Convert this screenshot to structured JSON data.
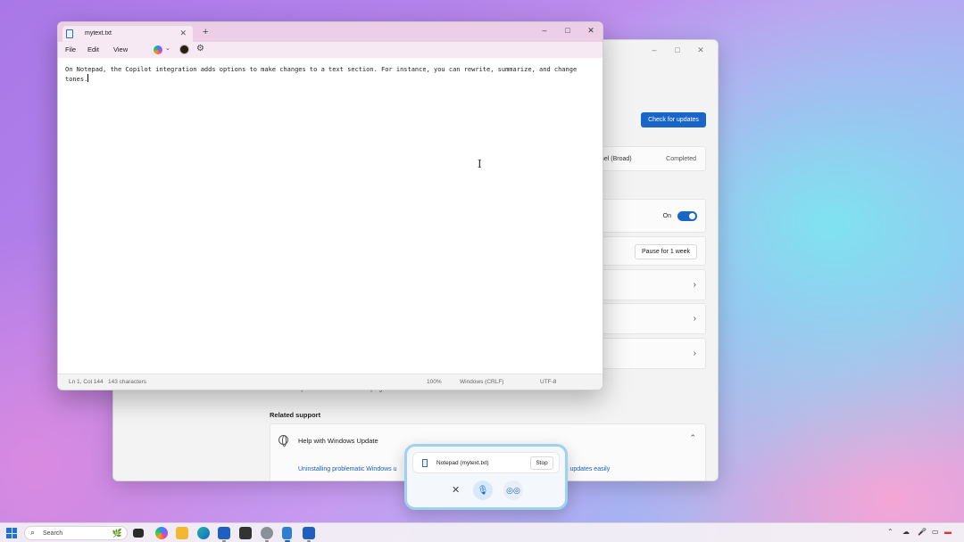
{
  "settings": {
    "check_updates_button": "Check for updates",
    "update_item_label": "nel (Broad)",
    "update_item_status": "Completed",
    "toggle_label": "On",
    "pause_button": "Pause for 1 week",
    "carbon_text": "Windows Update is committed to helping reduce carbon emissions.",
    "carbon_link": "Learn more",
    "related_support": "Related support",
    "help_title": "Help with Windows Update",
    "help_link_1": "Uninstalling problematic Windows u",
    "help_link_2": "s updates easily",
    "window_controls": [
      "–",
      "□",
      "✕"
    ]
  },
  "notepad": {
    "tab_title": "mytext.txt",
    "tab_close": "✕",
    "new_tab": "+",
    "window_controls": [
      "–",
      "□",
      "✕"
    ],
    "menu": {
      "file": "File",
      "edit": "Edit",
      "view": "View"
    },
    "content": "On Notepad, the Copilot integration adds options to make changes to a text section. For instance, you can rewrite, summarize, and change tones.",
    "status": {
      "position": "Ln 1, Col 144",
      "characters": "143 characters",
      "zoom": "100%",
      "line_ending": "Windows (CRLF)",
      "encoding": "UTF-8"
    }
  },
  "voice_panel": {
    "context_title": "Notepad (mytext.txt)",
    "stop_button": "Stop"
  },
  "taskbar": {
    "search_placeholder": "Search"
  },
  "colors": {
    "accent": "#1a66c8",
    "notepad_titlebar": "#eccfe6",
    "voice_border": "#9ed2ef"
  }
}
